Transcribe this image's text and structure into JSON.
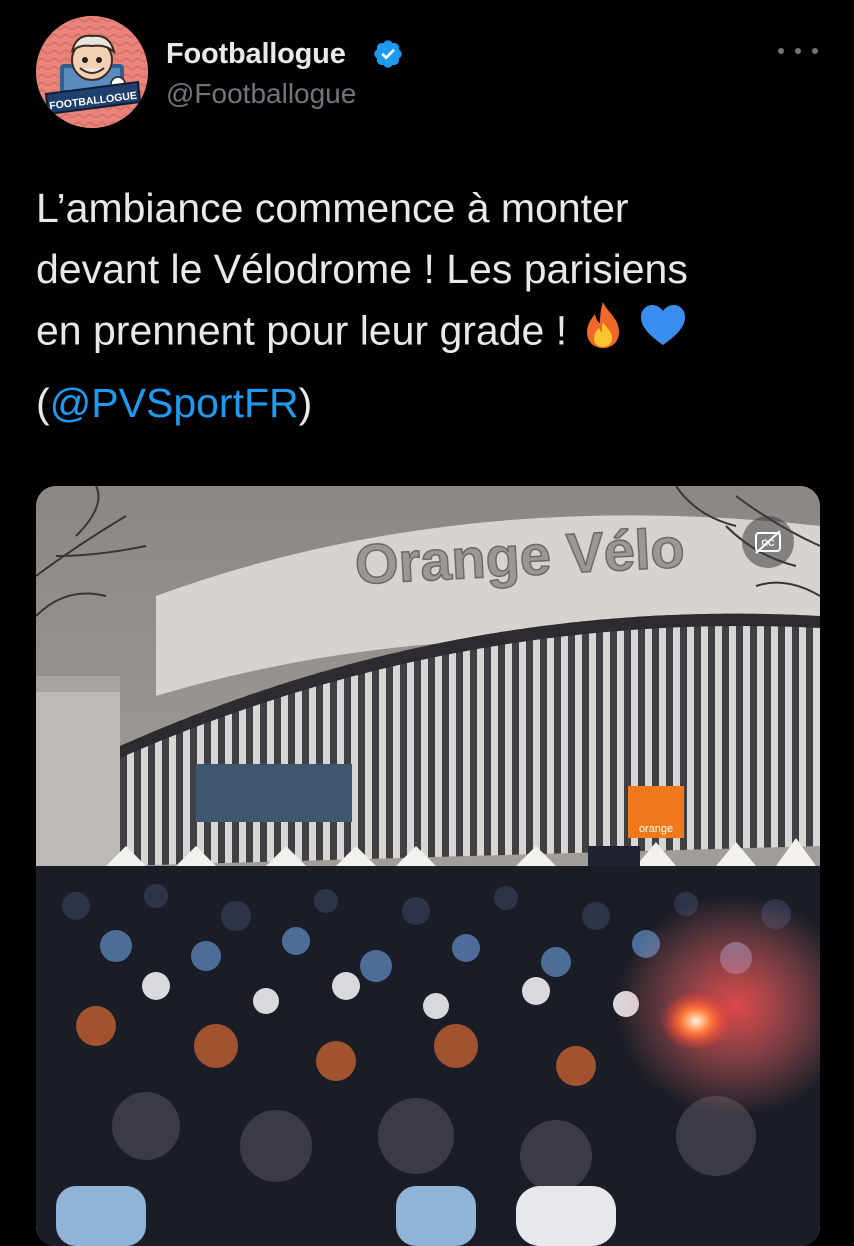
{
  "author": {
    "display_name": "Footballogue",
    "handle": "@Footballogue",
    "avatar_text": "FOOTBALLOGUE",
    "verified": true
  },
  "menu_icon": "more-horizontal-icon",
  "tweet": {
    "line1": "L’ambiance commence à monter",
    "line2": "devant le Vélodrome ! Les parisiens",
    "line3": "en prennent pour leur grade !",
    "emoji_1": "fire",
    "emoji_2": "blue-heart",
    "mention_open": "(",
    "mention": "@PVSportFR",
    "mention_close": ")"
  },
  "media": {
    "type": "video",
    "stadium_sign": "Orange Vélo",
    "orange_logo": "orange",
    "caption_icon": "closed-captions-icon"
  },
  "colors": {
    "background": "#000000",
    "text": "#e7e9ea",
    "secondary_text": "#71767b",
    "link": "#1d9bf0",
    "verified": "#1d9bf0",
    "avatar_bg": "#e8847a"
  }
}
